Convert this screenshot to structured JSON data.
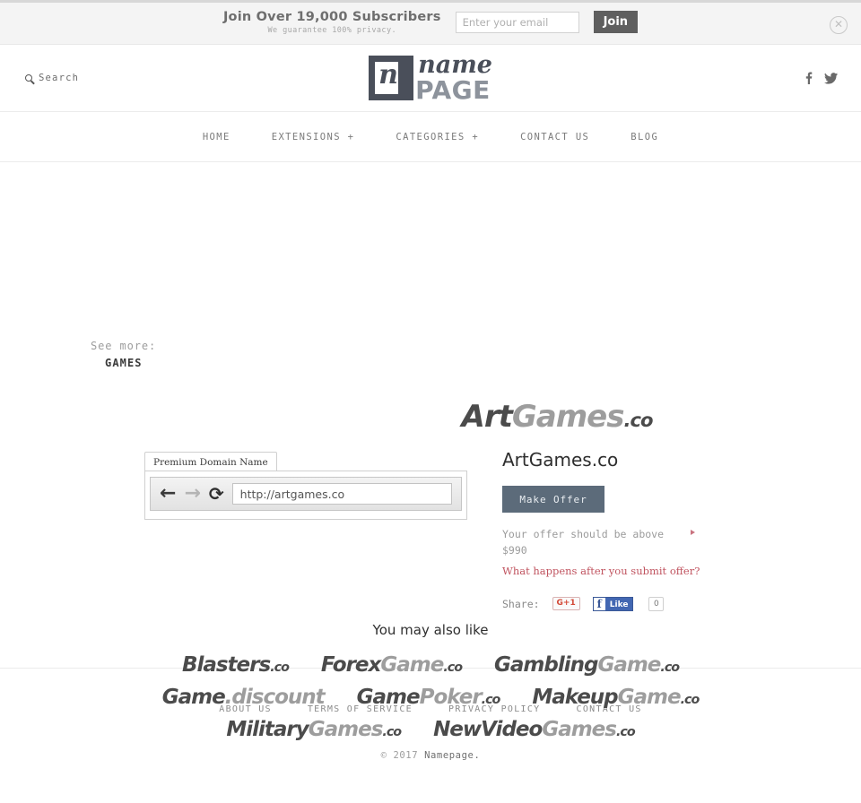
{
  "top_bar": {
    "headline": "Join Over 19,000 Subscribers",
    "subline": "We guarantee 100% privacy.",
    "email_placeholder": "Enter your email",
    "join_label": "Join",
    "close_icon": "close-circle-icon"
  },
  "header": {
    "search_label": "Search",
    "search_icon": "search-icon",
    "logo": {
      "mark_letter": "n",
      "name": "name",
      "page": "PAGE"
    },
    "social": [
      {
        "name": "facebook-icon",
        "glyph": "f"
      },
      {
        "name": "twitter-icon",
        "glyph": "t"
      }
    ]
  },
  "nav": {
    "items": [
      {
        "label": "HOME"
      },
      {
        "label": "EXTENSIONS +"
      },
      {
        "label": "CATEGORIES +"
      },
      {
        "label": "CONTACT US"
      },
      {
        "label": "BLOG"
      }
    ]
  },
  "breadcrumb": {
    "see_more_label": "See more:",
    "category": "GAMES"
  },
  "hero": {
    "logo": {
      "dark": "Art",
      "light": "Games",
      "tld": ".co"
    }
  },
  "browser": {
    "tab_label": "Premium Domain Name",
    "back_icon": "arrow-left-icon",
    "forward_icon": "arrow-right-icon",
    "reload_icon": "reload-icon",
    "url": "http://artgames.co"
  },
  "offer": {
    "domain": "ArtGames.co",
    "make_offer_label": "Make Offer",
    "note": "Your offer should be above $990",
    "minimum": "$990",
    "link": "What happens after you submit offer?",
    "share_label": "Share:",
    "gplus_label": "G+1",
    "fb_f": "f",
    "fb_like_label": "Like",
    "fb_count": "0",
    "accent_button": "#5c6b7a",
    "accent_link": "#c0535f"
  },
  "also_like": {
    "title": "You may also like",
    "items": [
      {
        "dark": "Blasters",
        "light": "",
        "tld": ".co"
      },
      {
        "dark": "Forex",
        "light": "Game",
        "tld": ".co"
      },
      {
        "dark": "Gambling",
        "light": "Game",
        "tld": ".co"
      },
      {
        "dark": "Game",
        "light": ".discount",
        "tld": ""
      },
      {
        "dark": "Game",
        "light": "Poker",
        "tld": ".co"
      },
      {
        "dark": "Makeup",
        "light": "Game",
        "tld": ".co"
      },
      {
        "dark": "Military",
        "light": "Games",
        "tld": ".co"
      },
      {
        "dark": "NewVideo",
        "light": "Games",
        "tld": ".co"
      }
    ]
  },
  "footer": {
    "links": [
      {
        "label": "ABOUT US"
      },
      {
        "label": "TERMS OF SERVICE"
      },
      {
        "label": "PRIVACY POLICY"
      },
      {
        "label": "CONTACT US"
      }
    ],
    "copyright_prefix": "© 2017 ",
    "copyright_brand": "Namepage."
  }
}
